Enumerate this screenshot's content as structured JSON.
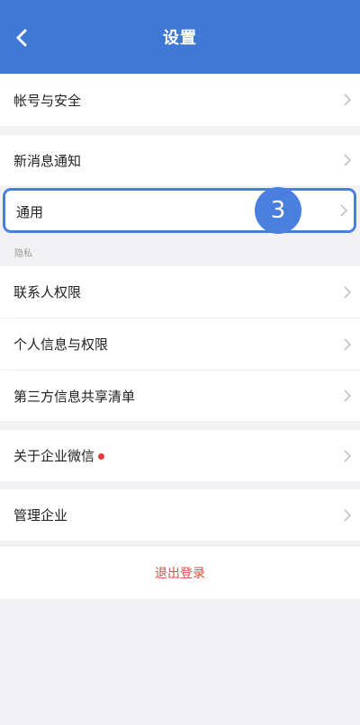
{
  "header": {
    "title": "设置",
    "back_icon": "chevron-left-icon",
    "background": "#4078d6"
  },
  "rows": {
    "account": "帐号与安全",
    "notifications": "新消息通知",
    "general": "通用",
    "contacts_permission": "联系人权限",
    "personal_info_permission": "个人信息与权限",
    "third_party_sharing": "第三方信息共享清单",
    "about": "关于企业微信",
    "manage_enterprise": "管理企业"
  },
  "privacy_section_label": "隐私",
  "step_badge": "3",
  "logout_label": "退出登录",
  "colors": {
    "accent": "#4a7fe0",
    "logout": "#e04a4a",
    "red_dot": "#e53e3e"
  }
}
